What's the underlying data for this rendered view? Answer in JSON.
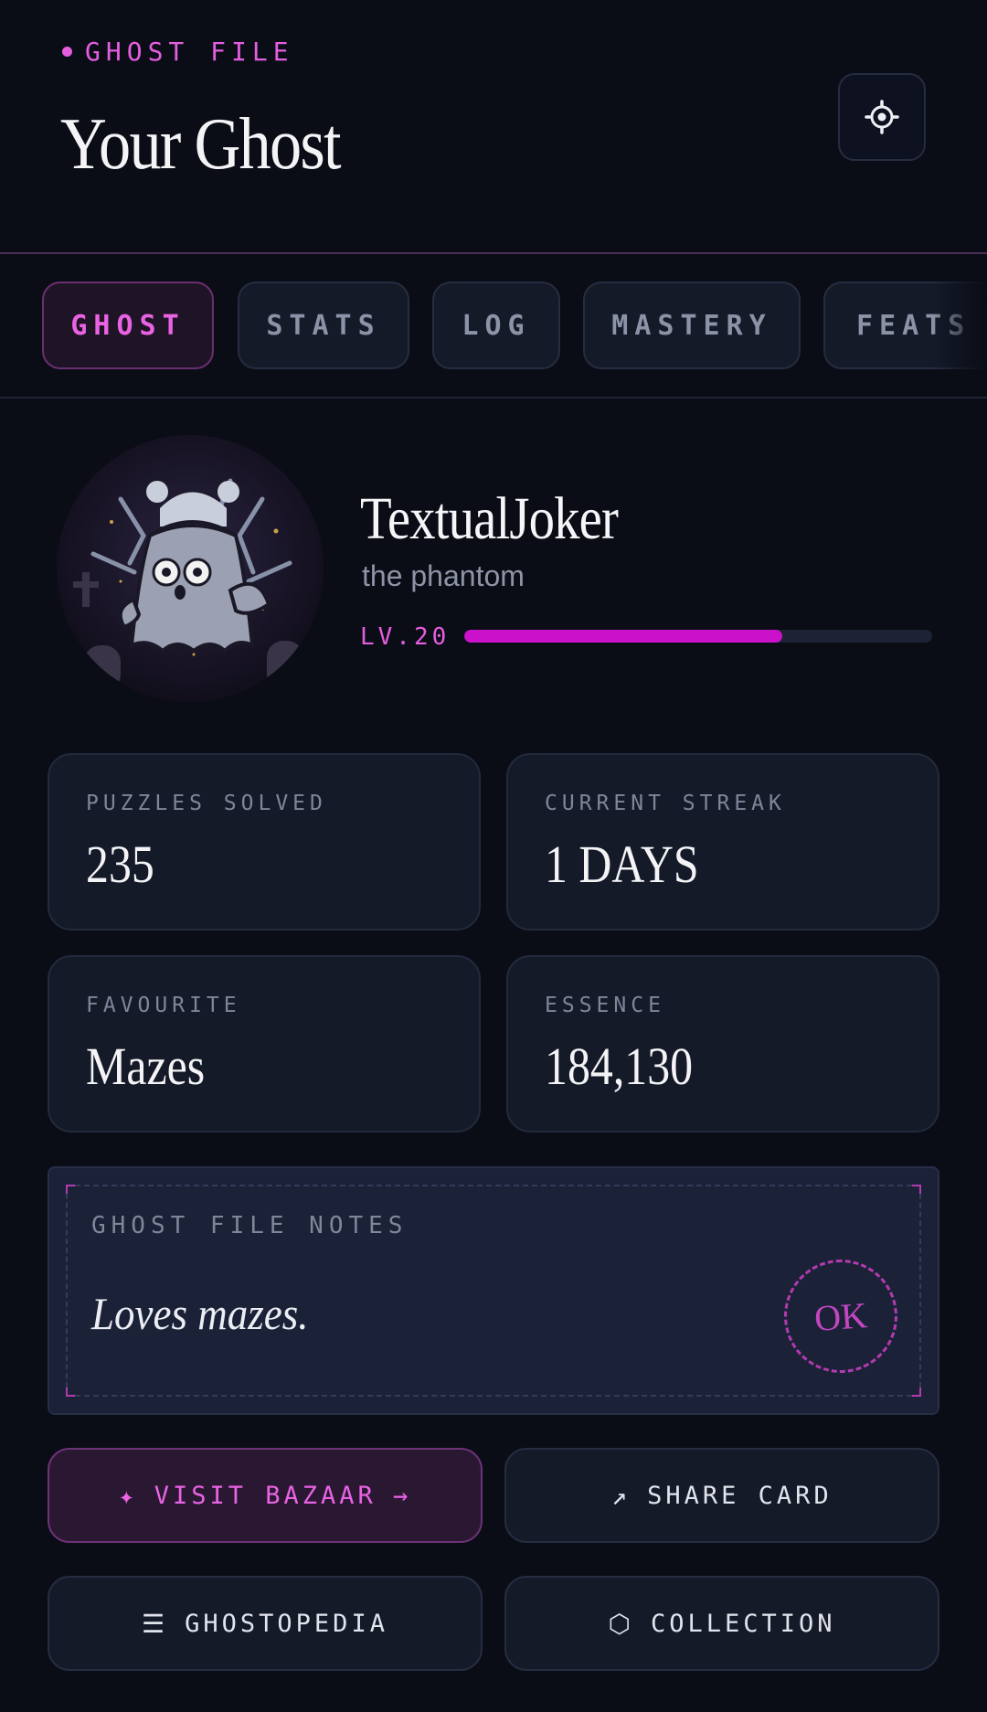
{
  "header": {
    "kicker": "GHOST FILE",
    "title": "Your Ghost",
    "settings_icon": "gear-icon"
  },
  "tabs": [
    {
      "label": "GHOST",
      "active": true
    },
    {
      "label": "STATS",
      "active": false
    },
    {
      "label": "LOG",
      "active": false
    },
    {
      "label": "MASTERY",
      "active": false
    },
    {
      "label": "FEATS",
      "active": false
    }
  ],
  "profile": {
    "name": "TextualJoker",
    "subtitle": "the phantom",
    "level": "LV.20",
    "xp_progress": 0.68
  },
  "stats": [
    {
      "label": "PUZZLES SOLVED",
      "value": "235"
    },
    {
      "label": "CURRENT STREAK",
      "value": "1 DAYS"
    },
    {
      "label": "FAVOURITE",
      "value": "Mazes"
    },
    {
      "label": "ESSENCE",
      "value": "184,130"
    }
  ],
  "notes": {
    "label": "GHOST FILE NOTES",
    "text": "Loves mazes.",
    "stamp": "OK"
  },
  "actions": {
    "bazaar": {
      "icon": "✦",
      "label": "VISIT BAZAAR",
      "arrow": "→"
    },
    "share": {
      "icon": "↗",
      "label": "SHARE CARD"
    },
    "ghostopedia": {
      "icon": "☰",
      "label": "GHOSTOPEDIA"
    },
    "collection": {
      "icon": "⬡",
      "label": "COLLECTION"
    }
  },
  "colors": {
    "accent": "#e55ee0",
    "xp_fill": "#c912c9",
    "background": "#0a0d16",
    "card": "#151a29"
  }
}
